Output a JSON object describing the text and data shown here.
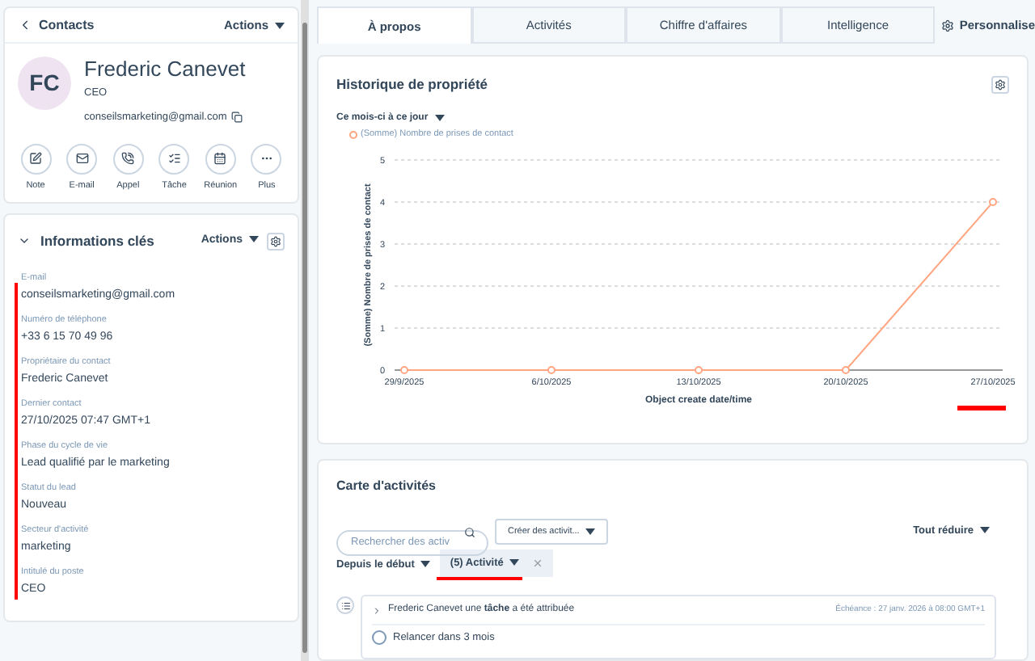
{
  "header": {
    "back": "Contacts",
    "actions": "Actions"
  },
  "contact": {
    "initials": "FC",
    "name": "Frederic Canevet",
    "title": "CEO",
    "email": "conseilsmarketing@gmail.com"
  },
  "quick_actions": [
    {
      "label": "Note",
      "kind": "note"
    },
    {
      "label": "E-mail",
      "kind": "email"
    },
    {
      "label": "Appel",
      "kind": "call"
    },
    {
      "label": "Tâche",
      "kind": "task"
    },
    {
      "label": "Réunion",
      "kind": "meeting"
    },
    {
      "label": "Plus",
      "kind": "more"
    }
  ],
  "key_info": {
    "title": "Informations clés",
    "actions": "Actions",
    "expanded": true,
    "fields": [
      {
        "label": "E-mail",
        "value": "conseilsmarketing@gmail.com"
      },
      {
        "label": "Numéro de téléphone",
        "value": "+33 6 15 70 49 96"
      },
      {
        "label": "Propriétaire du contact",
        "value": "Frederic Canevet"
      },
      {
        "label": "Dernier contact",
        "value": "27/10/2025 07:47 GMT+1"
      },
      {
        "label": "Phase du cycle de vie",
        "value": "Lead qualifié par le marketing"
      },
      {
        "label": "Statut du lead",
        "value": "Nouveau"
      },
      {
        "label": "Secteur d'activité",
        "value": "marketing"
      },
      {
        "label": "Intitulé du poste",
        "value": "CEO"
      }
    ]
  },
  "tabs": [
    {
      "label": "À propos",
      "selected": true
    },
    {
      "label": "Activités",
      "selected": false
    },
    {
      "label": "Chiffre d'affaires",
      "selected": false
    },
    {
      "label": "Intelligence",
      "selected": false
    }
  ],
  "customize": "Personnalise",
  "property_history": {
    "title": "Historique de propriété",
    "range": "Ce mois-ci à ce jour",
    "chart_data": {
      "type": "line",
      "grid": true,
      "marker": "circle",
      "xlabel": "Object create date/time",
      "ylabel": "(Somme) Nombre de prises de contact",
      "categories": [
        "29/9/2025",
        "6/10/2025",
        "13/10/2025",
        "20/10/2025",
        "27/10/2025"
      ],
      "series": [
        {
          "name": "(Somme) Nombre de prises de contact",
          "color": "#ffa581",
          "values": [
            0,
            0,
            0,
            0,
            4
          ]
        }
      ],
      "ylim": [
        0,
        5
      ],
      "yticks": [
        0,
        1,
        2,
        3,
        4,
        5
      ]
    }
  },
  "activity_card": {
    "title": "Carte d'activités",
    "search_placeholder": "Rechercher des activ",
    "create": "Créer des activit...",
    "collapse": "Tout réduire",
    "since": "Depuis le début",
    "filter": "(5) Activité",
    "activities": [
      {
        "prefix": "Frederic Canevet une **tâche** a été attribuée",
        "due": "Échéance : 27 janv. 2026 à 08:00 GMT+1",
        "task": "Relancer dans 3 mois",
        "done": false
      }
    ]
  }
}
